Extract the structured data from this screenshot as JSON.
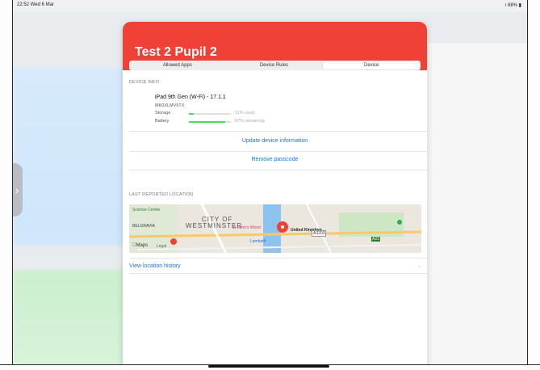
{
  "status_bar": {
    "time": "22:52  Wed 6 Mar",
    "battery": "≀ 68% ▮"
  },
  "modal": {
    "title": "Test 2 Pupil 2",
    "tabs": [
      {
        "label": "Allowed Apps",
        "selected": false
      },
      {
        "label": "Device Rules",
        "selected": false
      },
      {
        "label": "Device",
        "selected": true
      }
    ]
  },
  "device_info": {
    "section_label": "DEVICE INFO",
    "name": "iPad 9th Gen (W-Fi) - 17.1.1",
    "serial": "MK0XLMV9TX",
    "storage": {
      "label": "Storage",
      "value_text": "11% used",
      "fraction": 0.11
    },
    "battery": {
      "label": "Battery",
      "value_text": "87% remaining",
      "fraction": 0.87
    }
  },
  "actions": {
    "update_label": "Update device information",
    "remove_label": "Remove passcode"
  },
  "location": {
    "section_label": "LAST REPORTED LOCATION",
    "map_labels": {
      "city": "CITY OF",
      "district": "WESTMINSTER",
      "marker": "United Kingdom",
      "brand": "Maps",
      "legal": "Legal",
      "place1": "Science Centre",
      "place2": "BELGRAVIA",
      "place3": "St John's Wood",
      "place4": "Lambeth",
      "road1": "A3203",
      "road2": "A23"
    },
    "history_label": "View location history"
  },
  "colors": {
    "header": "#ef4136",
    "link": "#1a73e8",
    "battery_fill": "#4cd964"
  }
}
